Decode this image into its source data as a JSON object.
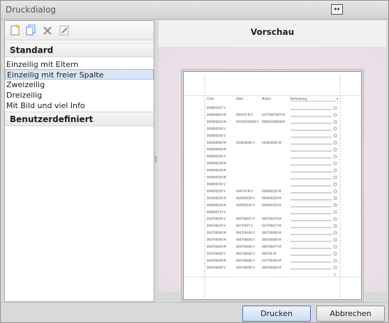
{
  "window": {
    "title": "Druckdialog",
    "title_button_glyph": "↔",
    "title_button_icon": "swap-horizontal-icon"
  },
  "toolbar": {
    "icons": [
      "new-icon",
      "copy-icon",
      "delete-icon",
      "edit-icon"
    ]
  },
  "templates": {
    "groups": [
      {
        "label": "Standard",
        "items": [
          {
            "label": "Einzeilig mit Eltern",
            "selected": false
          },
          {
            "label": "Einzeilig mit freier Spalte",
            "selected": true
          },
          {
            "label": "Zweizeilig",
            "selected": false
          },
          {
            "label": "Dreizeilig",
            "selected": false
          },
          {
            "label": "Mit Bild und viel Info",
            "selected": false
          }
        ]
      },
      {
        "label": "Benutzerdefiniert",
        "items": []
      }
    ]
  },
  "preview": {
    "title": "Vorschau",
    "columns": [
      "Code",
      "Vater",
      "Mutter",
      "Bemerkung"
    ],
    "rows": [
      [
        "000001047 V",
        "",
        ""
      ],
      [
        "000000820 M",
        "000470 M V",
        "04770007007 M"
      ],
      [
        "000004410 M",
        "00740100008 V",
        "00400100008 M"
      ],
      [
        "000000100 V",
        "",
        ""
      ],
      [
        "000000100 V",
        "",
        ""
      ],
      [
        "000000000 M",
        "010040000 V",
        "010040000 M"
      ],
      [
        "004000400 M",
        "",
        ""
      ],
      [
        "004000100 V",
        "",
        ""
      ],
      [
        "004000100 M",
        "",
        ""
      ],
      [
        "004000100 M",
        "",
        ""
      ],
      [
        "004000100 M",
        "",
        ""
      ],
      [
        "004000100 V",
        "",
        ""
      ],
      [
        "004000100 V",
        "004770 M V",
        "004000100 M"
      ],
      [
        "004000100 M",
        "004000100 V",
        "004000100 M"
      ],
      [
        "004000100 M",
        "004000100 V",
        "004000100 M"
      ],
      [
        "004000170 V",
        "",
        ""
      ],
      [
        "004700040 V",
        "004700407 V",
        "004700470 M"
      ],
      [
        "004700470 V",
        "04770077 V",
        "047700477 M"
      ],
      [
        "004700400 M",
        "004700400 V",
        "004700400 M"
      ],
      [
        "004700400 M",
        "004700400 V",
        "004700400 M"
      ],
      [
        "004700400 M",
        "004700400 V",
        "004700477 M"
      ],
      [
        "004700400 V",
        "004700400 V",
        "004700 M"
      ],
      [
        "004700400 M",
        "004700400 V",
        "047700400 M"
      ],
      [
        "004700400 V",
        "004700400 V",
        "004700400 M"
      ]
    ],
    "page_number": "1"
  },
  "buttons": {
    "print": "Drucken",
    "cancel": "Abbrechen"
  }
}
